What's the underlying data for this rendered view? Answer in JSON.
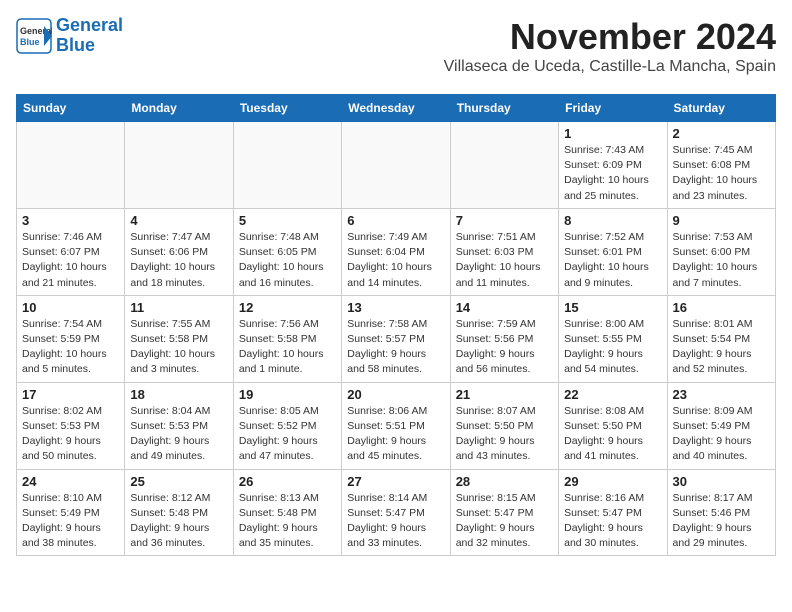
{
  "header": {
    "logo_line1": "General",
    "logo_line2": "Blue",
    "month": "November 2024",
    "location": "Villaseca de Uceda, Castille-La Mancha, Spain"
  },
  "weekdays": [
    "Sunday",
    "Monday",
    "Tuesday",
    "Wednesday",
    "Thursday",
    "Friday",
    "Saturday"
  ],
  "weeks": [
    [
      {
        "day": "",
        "info": ""
      },
      {
        "day": "",
        "info": ""
      },
      {
        "day": "",
        "info": ""
      },
      {
        "day": "",
        "info": ""
      },
      {
        "day": "",
        "info": ""
      },
      {
        "day": "1",
        "info": "Sunrise: 7:43 AM\nSunset: 6:09 PM\nDaylight: 10 hours and 25 minutes."
      },
      {
        "day": "2",
        "info": "Sunrise: 7:45 AM\nSunset: 6:08 PM\nDaylight: 10 hours and 23 minutes."
      }
    ],
    [
      {
        "day": "3",
        "info": "Sunrise: 7:46 AM\nSunset: 6:07 PM\nDaylight: 10 hours and 21 minutes."
      },
      {
        "day": "4",
        "info": "Sunrise: 7:47 AM\nSunset: 6:06 PM\nDaylight: 10 hours and 18 minutes."
      },
      {
        "day": "5",
        "info": "Sunrise: 7:48 AM\nSunset: 6:05 PM\nDaylight: 10 hours and 16 minutes."
      },
      {
        "day": "6",
        "info": "Sunrise: 7:49 AM\nSunset: 6:04 PM\nDaylight: 10 hours and 14 minutes."
      },
      {
        "day": "7",
        "info": "Sunrise: 7:51 AM\nSunset: 6:03 PM\nDaylight: 10 hours and 11 minutes."
      },
      {
        "day": "8",
        "info": "Sunrise: 7:52 AM\nSunset: 6:01 PM\nDaylight: 10 hours and 9 minutes."
      },
      {
        "day": "9",
        "info": "Sunrise: 7:53 AM\nSunset: 6:00 PM\nDaylight: 10 hours and 7 minutes."
      }
    ],
    [
      {
        "day": "10",
        "info": "Sunrise: 7:54 AM\nSunset: 5:59 PM\nDaylight: 10 hours and 5 minutes."
      },
      {
        "day": "11",
        "info": "Sunrise: 7:55 AM\nSunset: 5:58 PM\nDaylight: 10 hours and 3 minutes."
      },
      {
        "day": "12",
        "info": "Sunrise: 7:56 AM\nSunset: 5:58 PM\nDaylight: 10 hours and 1 minute."
      },
      {
        "day": "13",
        "info": "Sunrise: 7:58 AM\nSunset: 5:57 PM\nDaylight: 9 hours and 58 minutes."
      },
      {
        "day": "14",
        "info": "Sunrise: 7:59 AM\nSunset: 5:56 PM\nDaylight: 9 hours and 56 minutes."
      },
      {
        "day": "15",
        "info": "Sunrise: 8:00 AM\nSunset: 5:55 PM\nDaylight: 9 hours and 54 minutes."
      },
      {
        "day": "16",
        "info": "Sunrise: 8:01 AM\nSunset: 5:54 PM\nDaylight: 9 hours and 52 minutes."
      }
    ],
    [
      {
        "day": "17",
        "info": "Sunrise: 8:02 AM\nSunset: 5:53 PM\nDaylight: 9 hours and 50 minutes."
      },
      {
        "day": "18",
        "info": "Sunrise: 8:04 AM\nSunset: 5:53 PM\nDaylight: 9 hours and 49 minutes."
      },
      {
        "day": "19",
        "info": "Sunrise: 8:05 AM\nSunset: 5:52 PM\nDaylight: 9 hours and 47 minutes."
      },
      {
        "day": "20",
        "info": "Sunrise: 8:06 AM\nSunset: 5:51 PM\nDaylight: 9 hours and 45 minutes."
      },
      {
        "day": "21",
        "info": "Sunrise: 8:07 AM\nSunset: 5:50 PM\nDaylight: 9 hours and 43 minutes."
      },
      {
        "day": "22",
        "info": "Sunrise: 8:08 AM\nSunset: 5:50 PM\nDaylight: 9 hours and 41 minutes."
      },
      {
        "day": "23",
        "info": "Sunrise: 8:09 AM\nSunset: 5:49 PM\nDaylight: 9 hours and 40 minutes."
      }
    ],
    [
      {
        "day": "24",
        "info": "Sunrise: 8:10 AM\nSunset: 5:49 PM\nDaylight: 9 hours and 38 minutes."
      },
      {
        "day": "25",
        "info": "Sunrise: 8:12 AM\nSunset: 5:48 PM\nDaylight: 9 hours and 36 minutes."
      },
      {
        "day": "26",
        "info": "Sunrise: 8:13 AM\nSunset: 5:48 PM\nDaylight: 9 hours and 35 minutes."
      },
      {
        "day": "27",
        "info": "Sunrise: 8:14 AM\nSunset: 5:47 PM\nDaylight: 9 hours and 33 minutes."
      },
      {
        "day": "28",
        "info": "Sunrise: 8:15 AM\nSunset: 5:47 PM\nDaylight: 9 hours and 32 minutes."
      },
      {
        "day": "29",
        "info": "Sunrise: 8:16 AM\nSunset: 5:47 PM\nDaylight: 9 hours and 30 minutes."
      },
      {
        "day": "30",
        "info": "Sunrise: 8:17 AM\nSunset: 5:46 PM\nDaylight: 9 hours and 29 minutes."
      }
    ]
  ]
}
